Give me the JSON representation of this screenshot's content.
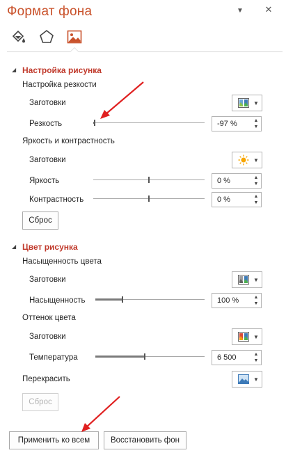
{
  "pane": {
    "title": "Формат фона",
    "menu_glyph": "▼",
    "close_glyph": "✕"
  },
  "tabs": [
    {
      "name": "fill-icon"
    },
    {
      "name": "effects-pentagon-icon"
    },
    {
      "name": "picture-icon",
      "active": true
    }
  ],
  "picture_settings": {
    "header": "Настройка рисунка",
    "sharpness_group": "Настройка резкости",
    "presets_label_1": "Заготовки",
    "sharpness_label": "Резкость",
    "sharpness_value": "-97 %",
    "sharpness_fraction": 0.015,
    "brightness_group": "Яркость и контрастность",
    "presets_label_2": "Заготовки",
    "brightness_label": "Яркость",
    "brightness_value": "0 %",
    "brightness_fraction": 0.5,
    "contrast_label": "Контрастность",
    "contrast_value": "0 %",
    "contrast_fraction": 0.5,
    "reset_label": "Сброс"
  },
  "picture_color": {
    "header": "Цвет рисунка",
    "saturation_group": "Насыщенность цвета",
    "presets_label_1": "Заготовки",
    "saturation_label": "Насыщенность",
    "saturation_value": "100 %",
    "saturation_fraction": 0.25,
    "tone_group": "Оттенок цвета",
    "presets_label_2": "Заготовки",
    "temperature_label": "Температура",
    "temperature_value": "6 500",
    "temperature_fraction": 0.45,
    "recolor_label": "Перекрасить",
    "reset_label": "Сброс"
  },
  "footer": {
    "apply_all_label": "Применить ко всем",
    "reset_background_label": "Восстановить фон"
  },
  "colors": {
    "title": "#c9512a",
    "section_header": "#c0392b",
    "annotation_arrow": "#e02020"
  }
}
